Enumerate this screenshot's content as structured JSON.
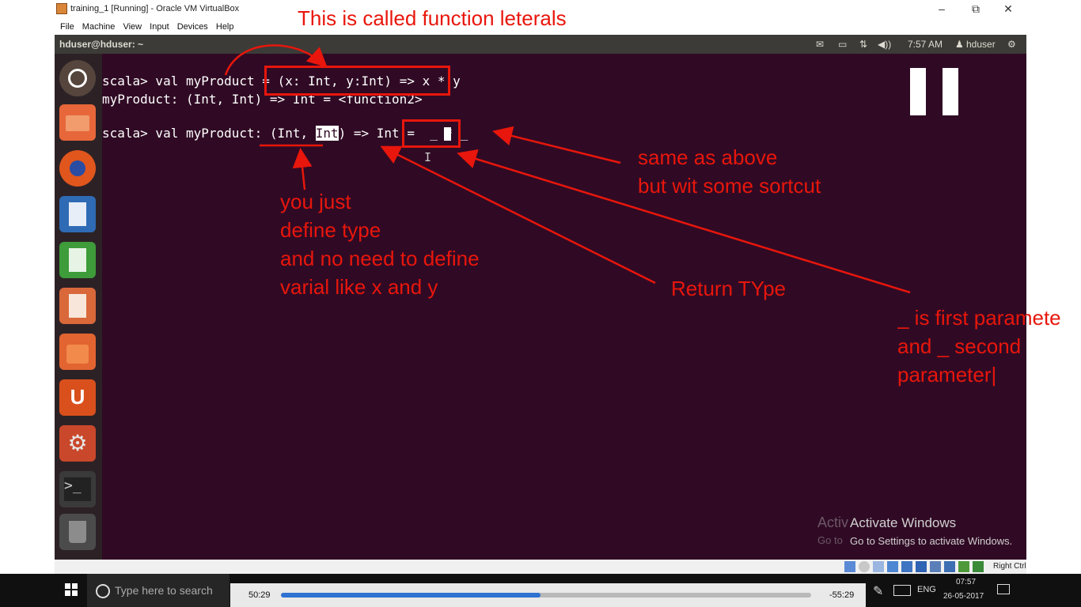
{
  "window": {
    "title": "training_1 [Running] - Oracle VM VirtualBox",
    "menu": [
      "File",
      "Machine",
      "View",
      "Input",
      "Devices",
      "Help"
    ],
    "controls": {
      "minimize": "–",
      "maximize": "⧉",
      "close": "✕"
    }
  },
  "ubuntu_panel": {
    "title": "hduser@hduser: ~",
    "time": "7:57 AM",
    "user": "hduser"
  },
  "launcher": {
    "items": [
      "ubuntu-dash",
      "files",
      "firefox",
      "libreoffice-writer",
      "libreoffice-calc",
      "libreoffice-impress",
      "software-center",
      "ubuntu-one",
      "system-settings",
      "terminal",
      "trash"
    ]
  },
  "terminal": {
    "line1_prompt": "scala> val myProduct = ",
    "line1_expr": "(x: Int, y:Int) => x * y",
    "line2": "myProduct: (Int, Int) => Int = <function2>",
    "line3_prefix": "scala> val myProduct: (Int, ",
    "line3_highlight": "Int",
    "line3_middle": ") => Int =  ",
    "line3_expr": "_ * _",
    "cursor_char": "I"
  },
  "annotations": {
    "title": "This is called function leterals",
    "same_as_above_1": "same as above",
    "same_as_above_2": "but wit some sortcut",
    "define_type_1": "you just",
    "define_type_2": "define type",
    "define_type_3": "and no need to define",
    "define_type_4": "varial like x and y",
    "return_type": "Return TYpe",
    "params_1": "_ is first paramete",
    "params_2": "and _ second",
    "params_3": "parameter|",
    "color": "#e8160c"
  },
  "activation": {
    "line1": "Activate Windows",
    "line2": "Go to Settings to activate Windows.",
    "ghost1": "Activ",
    "ghost2": "Go to"
  },
  "vbox_status": {
    "right_ctrl": "Right Ctrl"
  },
  "taskbar": {
    "search_placeholder": "Type here to search",
    "elapsed": "50:29",
    "remaining": "-55:29",
    "progress_fraction": 0.49,
    "language": "ENG",
    "clock_time": "07:57",
    "clock_date": "26-05-2017"
  }
}
